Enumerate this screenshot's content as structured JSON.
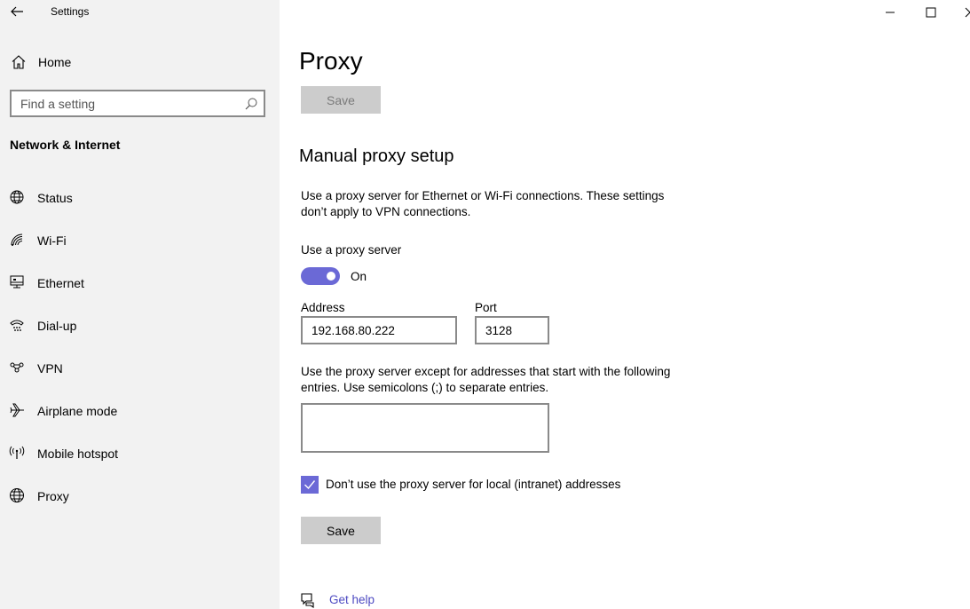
{
  "app": {
    "title": "Settings"
  },
  "sidebar": {
    "home_label": "Home",
    "search_placeholder": "Find a setting",
    "section_title": "Network & Internet",
    "items": [
      {
        "label": "Status",
        "icon": "globe-status-icon"
      },
      {
        "label": "Wi-Fi",
        "icon": "wifi-icon"
      },
      {
        "label": "Ethernet",
        "icon": "ethernet-icon"
      },
      {
        "label": "Dial-up",
        "icon": "dialup-icon"
      },
      {
        "label": "VPN",
        "icon": "vpn-icon"
      },
      {
        "label": "Airplane mode",
        "icon": "airplane-icon"
      },
      {
        "label": "Mobile hotspot",
        "icon": "hotspot-icon"
      },
      {
        "label": "Proxy",
        "icon": "globe-icon"
      }
    ]
  },
  "main": {
    "page_title": "Proxy",
    "top_save_label": "Save",
    "manual_heading": "Manual proxy setup",
    "manual_desc": "Use a proxy server for Ethernet or Wi-Fi connections. These settings don’t apply to VPN connections.",
    "use_proxy_label": "Use a proxy server",
    "toggle_state": "On",
    "address_label": "Address",
    "address_value": "192.168.80.222",
    "port_label": "Port",
    "port_value": "3128",
    "exceptions_desc": "Use the proxy server except for addresses that start with the following entries. Use semicolons (;) to separate entries.",
    "exceptions_value": "",
    "local_checkbox_label": "Don’t use the proxy server for local (intranet) addresses",
    "local_checkbox_checked": true,
    "bottom_save_label": "Save",
    "help_label": "Get help"
  },
  "colors": {
    "accent": "#6b69d6",
    "sidebar_bg": "#f2f2f2",
    "button_bg": "#cccccc",
    "link": "#4d4ac2"
  }
}
